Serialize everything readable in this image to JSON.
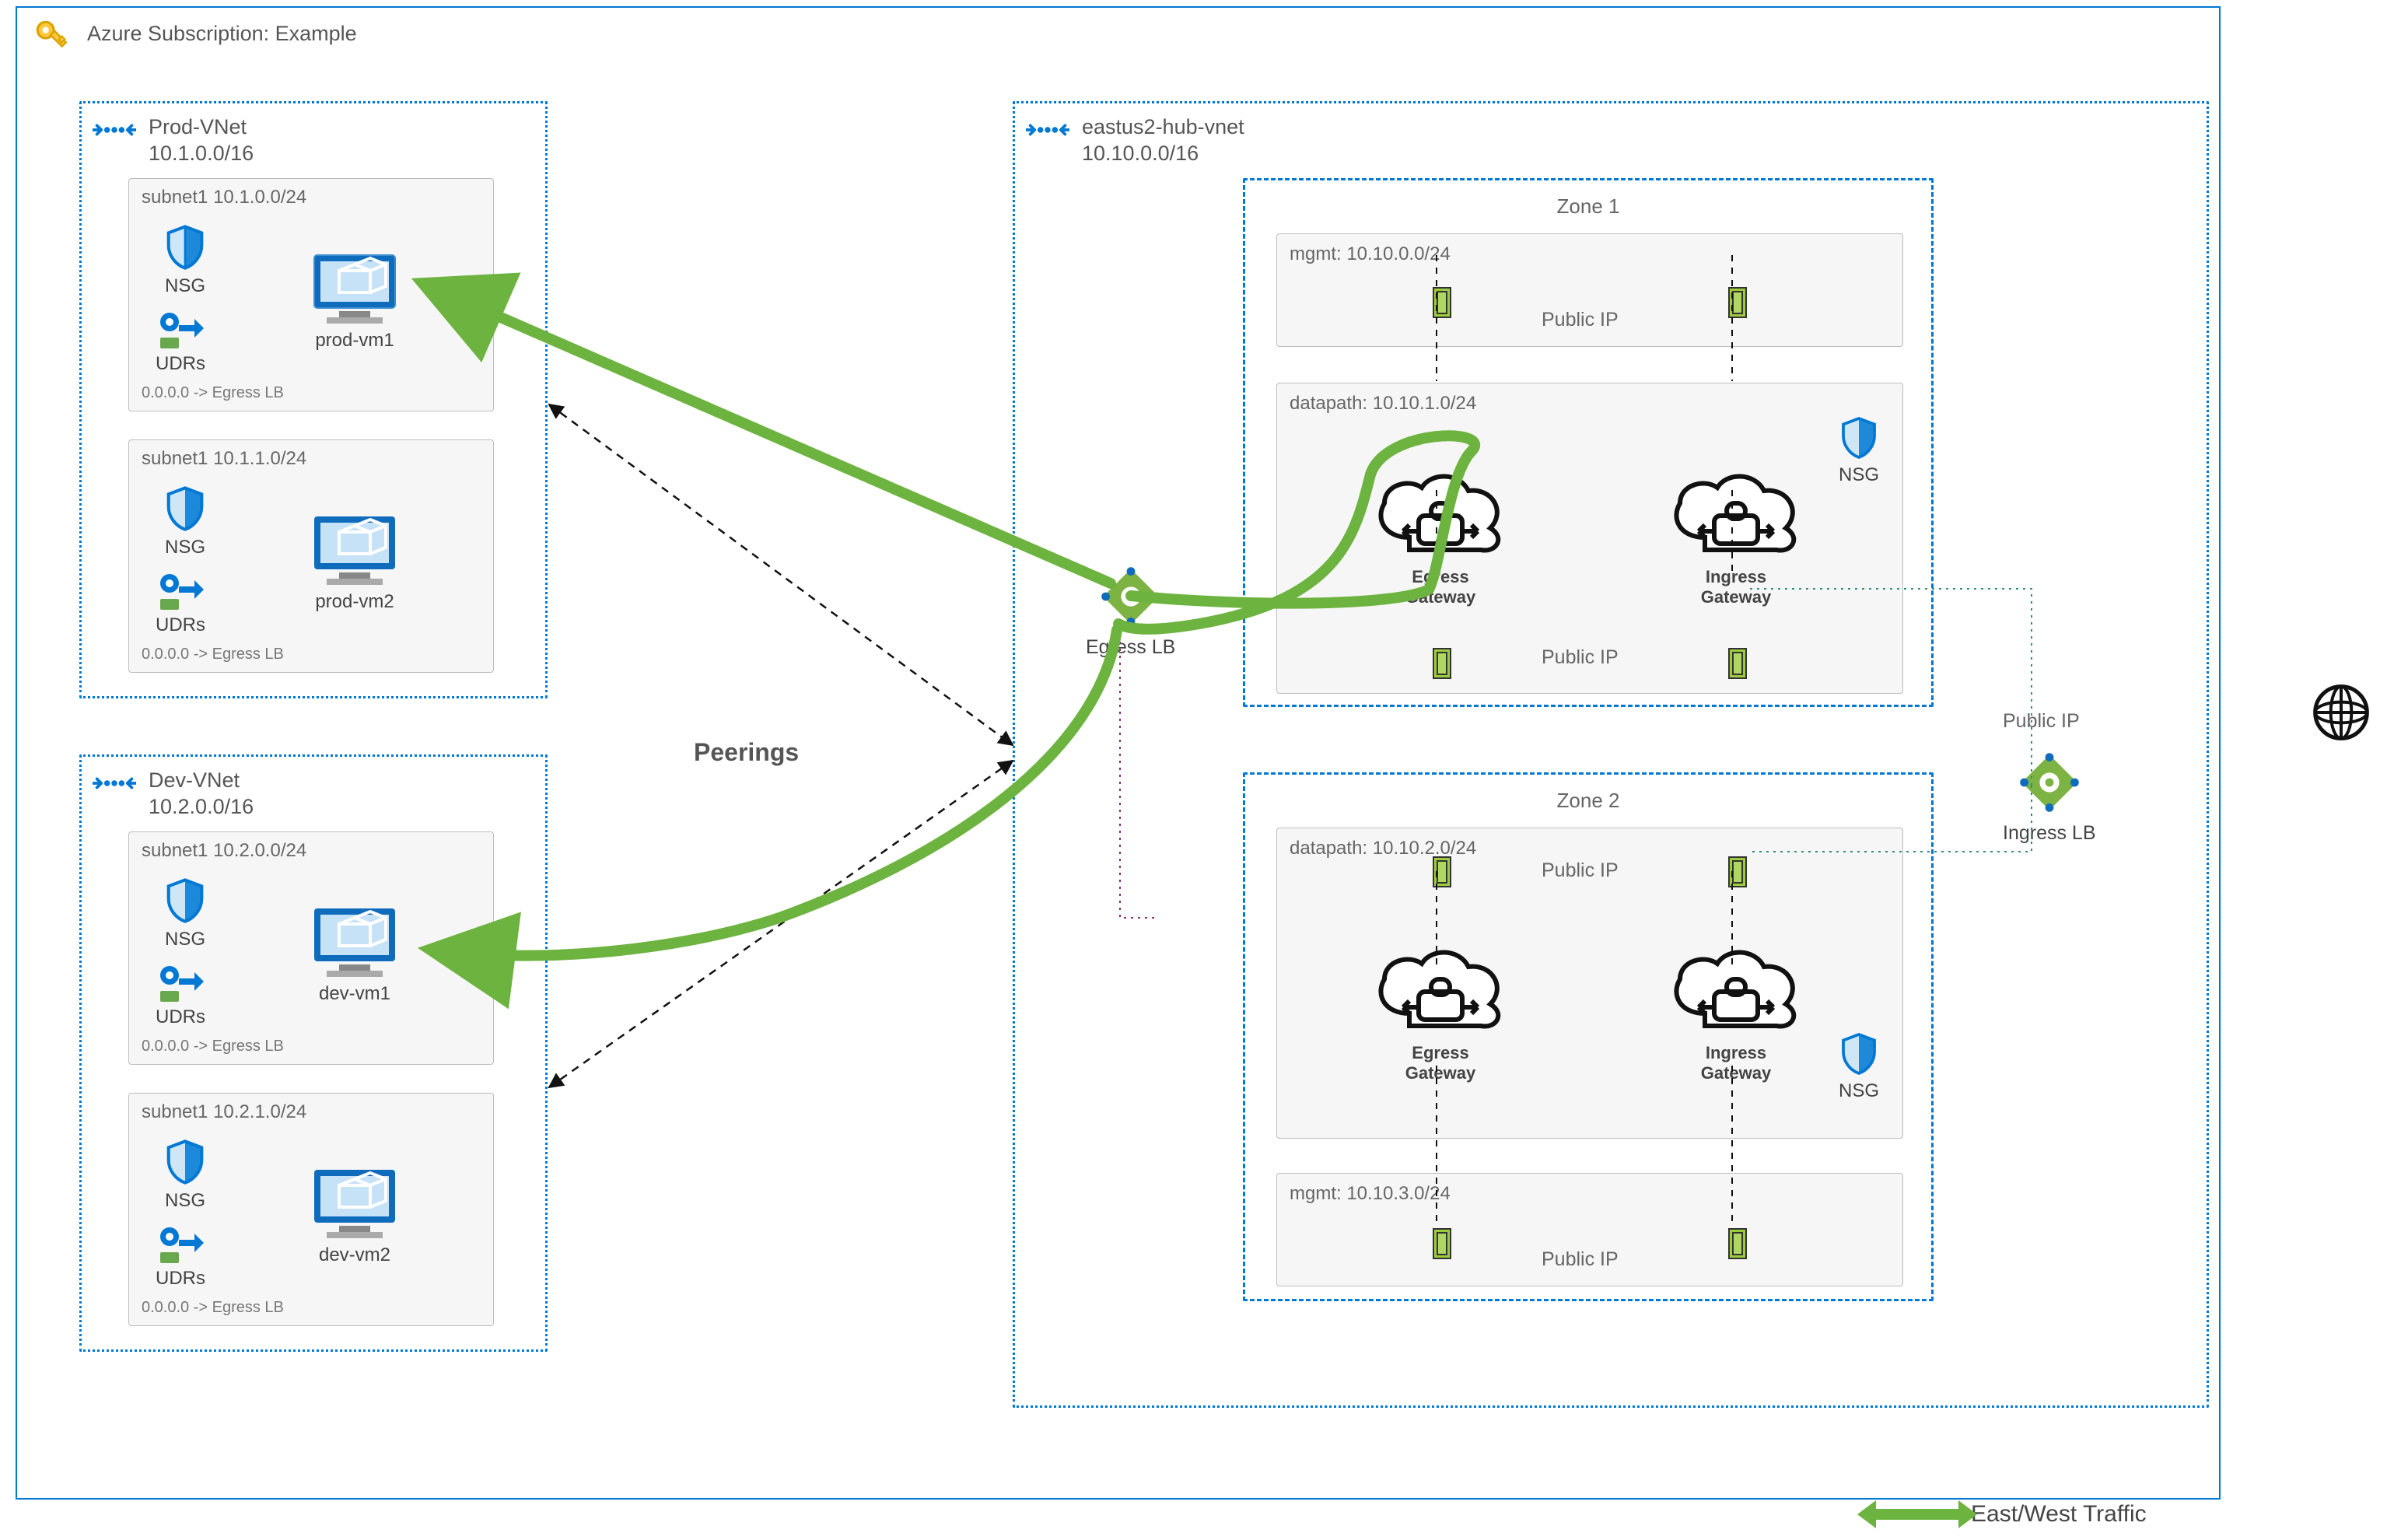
{
  "subscription": {
    "title": "Azure Subscription: Example"
  },
  "prod_vnet": {
    "name": "Prod-VNet",
    "cidr": "10.1.0.0/16",
    "subnet1": {
      "label": "subnet1  10.1.0.0/24",
      "nsg": "NSG",
      "udr": "UDRs",
      "udr_note": "0.0.0.0 -> Egress LB",
      "vm": "prod-vm1"
    },
    "subnet2": {
      "label": "subnet1  10.1.1.0/24",
      "nsg": "NSG",
      "udr": "UDRs",
      "udr_note": "0.0.0.0 -> Egress LB",
      "vm": "prod-vm2"
    }
  },
  "dev_vnet": {
    "name": "Dev-VNet",
    "cidr": "10.2.0.0/16",
    "subnet1": {
      "label": "subnet1  10.2.0.0/24",
      "nsg": "NSG",
      "udr": "UDRs",
      "udr_note": "0.0.0.0 -> Egress LB",
      "vm": "dev-vm1"
    },
    "subnet2": {
      "label": "subnet1  10.2.1.0/24",
      "nsg": "NSG",
      "udr": "UDRs",
      "udr_note": "0.0.0.0 -> Egress LB",
      "vm": "dev-vm2"
    }
  },
  "hub_vnet": {
    "name": "eastus2-hub-vnet",
    "cidr": "10.10.0.0/16",
    "zone1": {
      "title": "Zone 1",
      "mgmt": {
        "label": "mgmt: 10.10.0.0/24",
        "pubip": "Public IP"
      },
      "data": {
        "label": "datapath: 10.10.1.0/24",
        "pubip": "Public IP",
        "nsg": "NSG",
        "egress": "Egress\nGateway",
        "ingress": "Ingress\nGateway"
      }
    },
    "zone2": {
      "title": "Zone 2",
      "data": {
        "label": "datapath: 10.10.2.0/24",
        "pubip": "Public IP",
        "nsg": "NSG",
        "egress": "Egress\nGateway",
        "ingress": "Ingress\nGateway"
      },
      "mgmt": {
        "label": "mgmt: 10.10.3.0/24",
        "pubip": "Public IP"
      }
    },
    "egress_lb": "Egress LB",
    "ingress_lb": "Ingress LB",
    "ingress_pubip": "Public IP"
  },
  "center": {
    "peerings": "Peerings"
  },
  "legend": {
    "ew": "East/West Traffic"
  }
}
